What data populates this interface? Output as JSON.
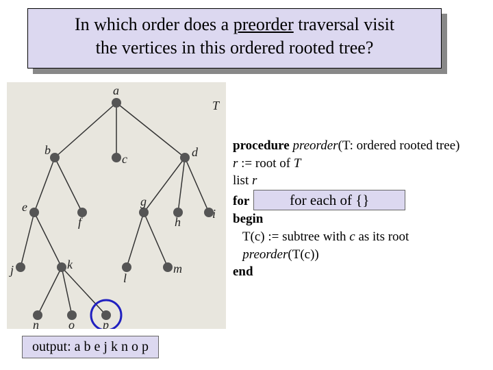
{
  "title": {
    "line1_prefix": "In which order does a ",
    "line1_underlined": "preorder",
    "line1_suffix": " traversal visit",
    "line2": "the vertices in this ordered rooted tree?"
  },
  "tree": {
    "tree_label": "T",
    "nodes": {
      "a": "a",
      "b": "b",
      "c": "c",
      "d": "d",
      "e": "e",
      "f": "f",
      "g": "g",
      "h": "h",
      "i": "i",
      "j": "j",
      "k": "k",
      "l": "l",
      "m": "m",
      "n": "n",
      "o": "o",
      "p": "p"
    },
    "circled_node": "p"
  },
  "pseudocode": {
    "l1_kw": "procedure",
    "l1_name": "preorder",
    "l1_params": "(T: ordered rooted tree)",
    "l2_var": "r",
    "l2_rest": " := root of ",
    "l2_T": "T",
    "l3_kw": "list ",
    "l3_var": "r",
    "l4_kw": "for",
    "l4_highlight": "for each of {}",
    "l5_kw": "begin",
    "l6_pre": "   T(c) := subtree with ",
    "l6_c": "c",
    "l6_post": " as its root",
    "l7_pre": "   ",
    "l7_name": "preorder",
    "l7_post": "(T(c))",
    "l8_kw": "end"
  },
  "output": {
    "text": "output: a b e j k n o p"
  }
}
